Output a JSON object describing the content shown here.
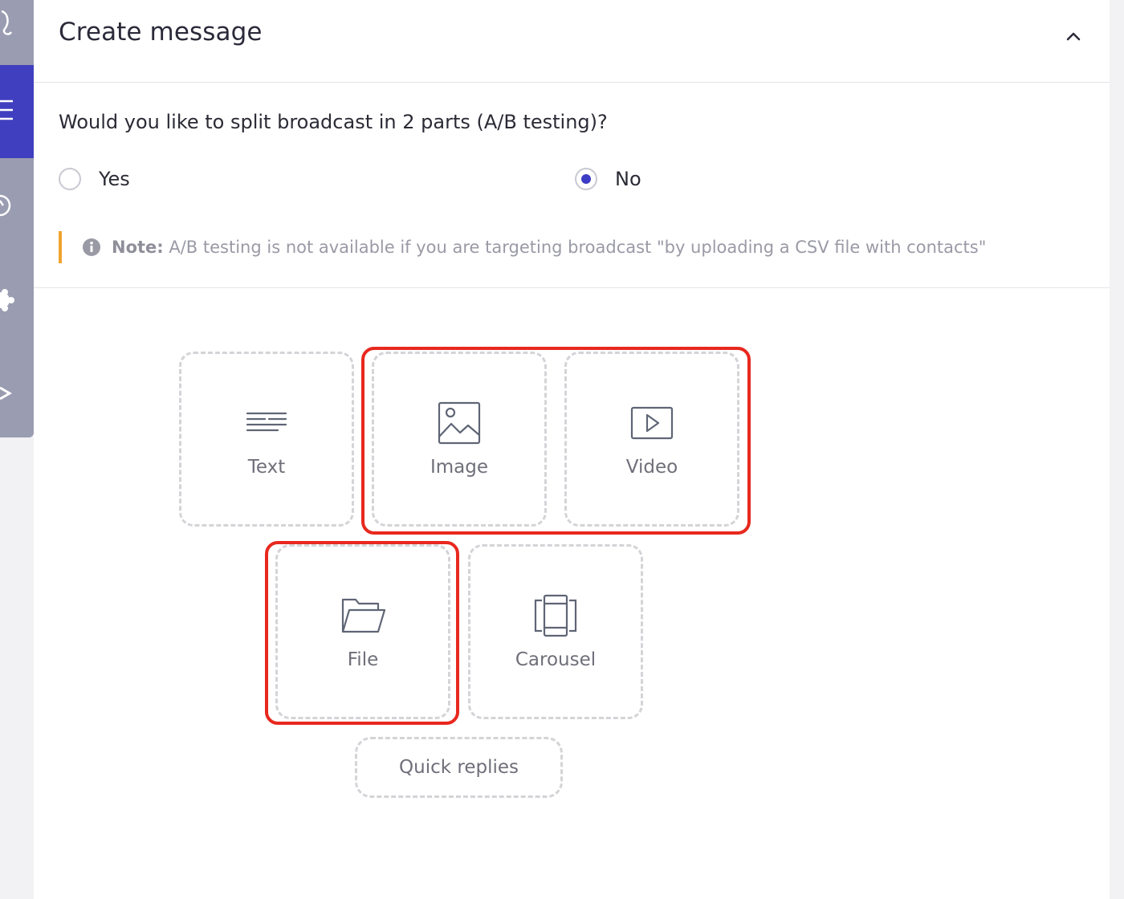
{
  "header": {
    "title": "Create message"
  },
  "ab_test": {
    "question": "Would you like to split broadcast in 2 parts (A/B testing)?",
    "options": [
      {
        "label": "Yes",
        "checked": false
      },
      {
        "label": "No",
        "checked": true
      }
    ],
    "note_label": "Note:",
    "note_text": " A/B testing is not available if you are targeting broadcast \"by uploading a CSV file with contacts\""
  },
  "message_types": [
    {
      "label": "Text",
      "icon": "text-lines-icon"
    },
    {
      "label": "Image",
      "icon": "image-icon"
    },
    {
      "label": "Video",
      "icon": "video-play-icon"
    },
    {
      "label": "File",
      "icon": "folder-icon"
    },
    {
      "label": "Carousel",
      "icon": "carousel-icon"
    }
  ],
  "quick_replies": {
    "label": "Quick replies"
  },
  "colors": {
    "accent": "#3c3cc4",
    "sidebar": "#9a9cb1",
    "note_bar": "#f0a32f",
    "highlight": "#e8281e"
  }
}
